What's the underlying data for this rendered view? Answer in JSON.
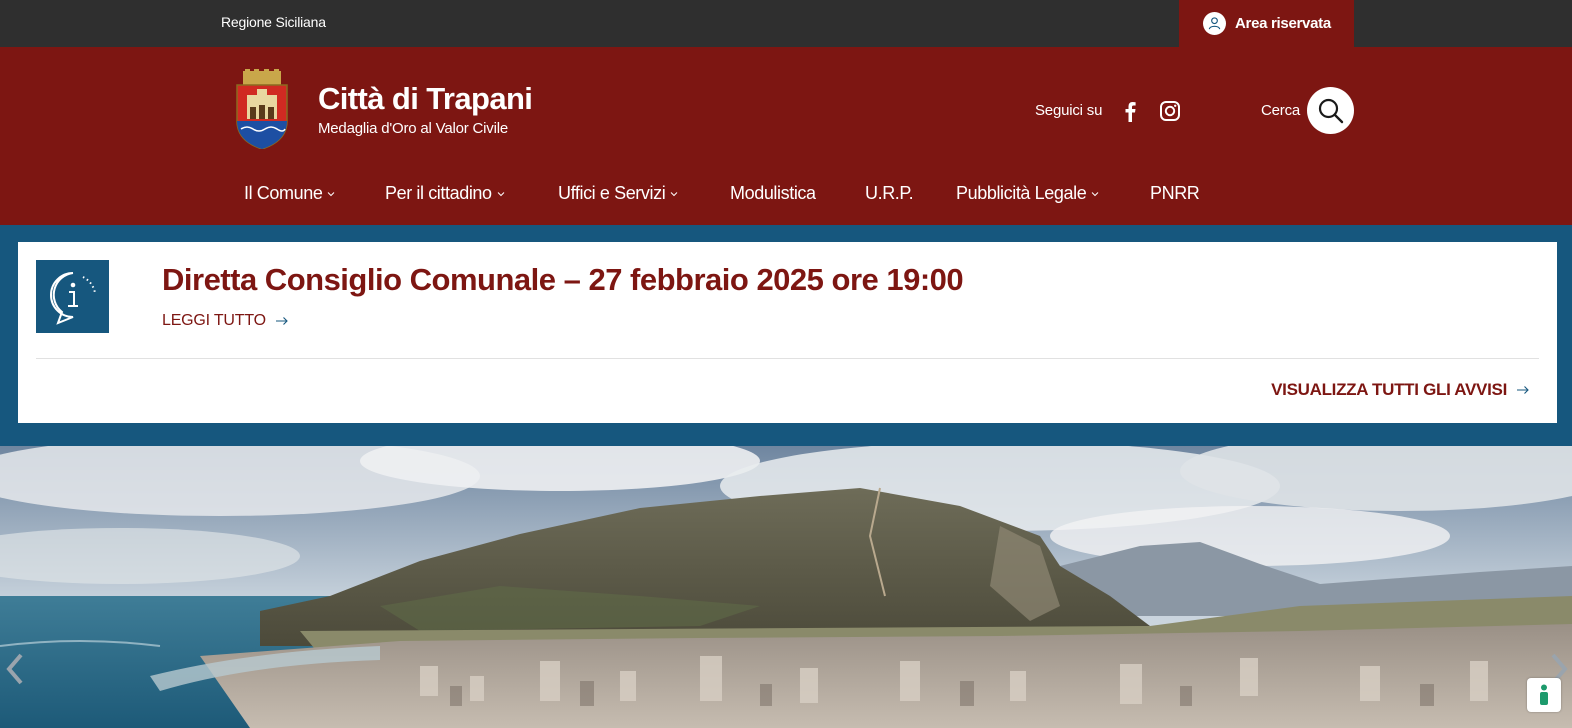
{
  "topbar": {
    "region_label": "Regione Siciliana",
    "reserved_area_label": "Area riservata"
  },
  "header": {
    "title": "Città di Trapani",
    "subtitle": "Medaglia d'Oro al Valor Civile",
    "social_label": "Seguici su",
    "search_label": "Cerca"
  },
  "nav": {
    "items": [
      {
        "label": "Il Comune",
        "has_dropdown": true
      },
      {
        "label": "Per il cittadino",
        "has_dropdown": true
      },
      {
        "label": "Uffici e Servizi",
        "has_dropdown": true
      },
      {
        "label": "Modulistica",
        "has_dropdown": false
      },
      {
        "label": "U.R.P.",
        "has_dropdown": false
      },
      {
        "label": "Pubblicità Legale",
        "has_dropdown": true
      },
      {
        "label": "PNRR",
        "has_dropdown": false
      }
    ]
  },
  "alert": {
    "title": "Diretta Consiglio Comunale – 27 febbraio 2025 ore 19:00",
    "read_more": "LEGGI TUTTO",
    "view_all": "VISUALIZZA TUTTI GLI AVVISI"
  },
  "icons": {
    "user": "user-icon",
    "facebook": "facebook-icon",
    "instagram": "instagram-icon",
    "search": "search-icon",
    "info": "info-speech-bubble-icon",
    "arrow": "arrow-right-icon",
    "prev": "chevron-left-icon",
    "next": "chevron-right-icon",
    "accessibility": "accessibility-icon"
  },
  "colors": {
    "brand_red": "#7d1612",
    "top_dark": "#2f2f2f",
    "alert_blue": "#16577e"
  }
}
